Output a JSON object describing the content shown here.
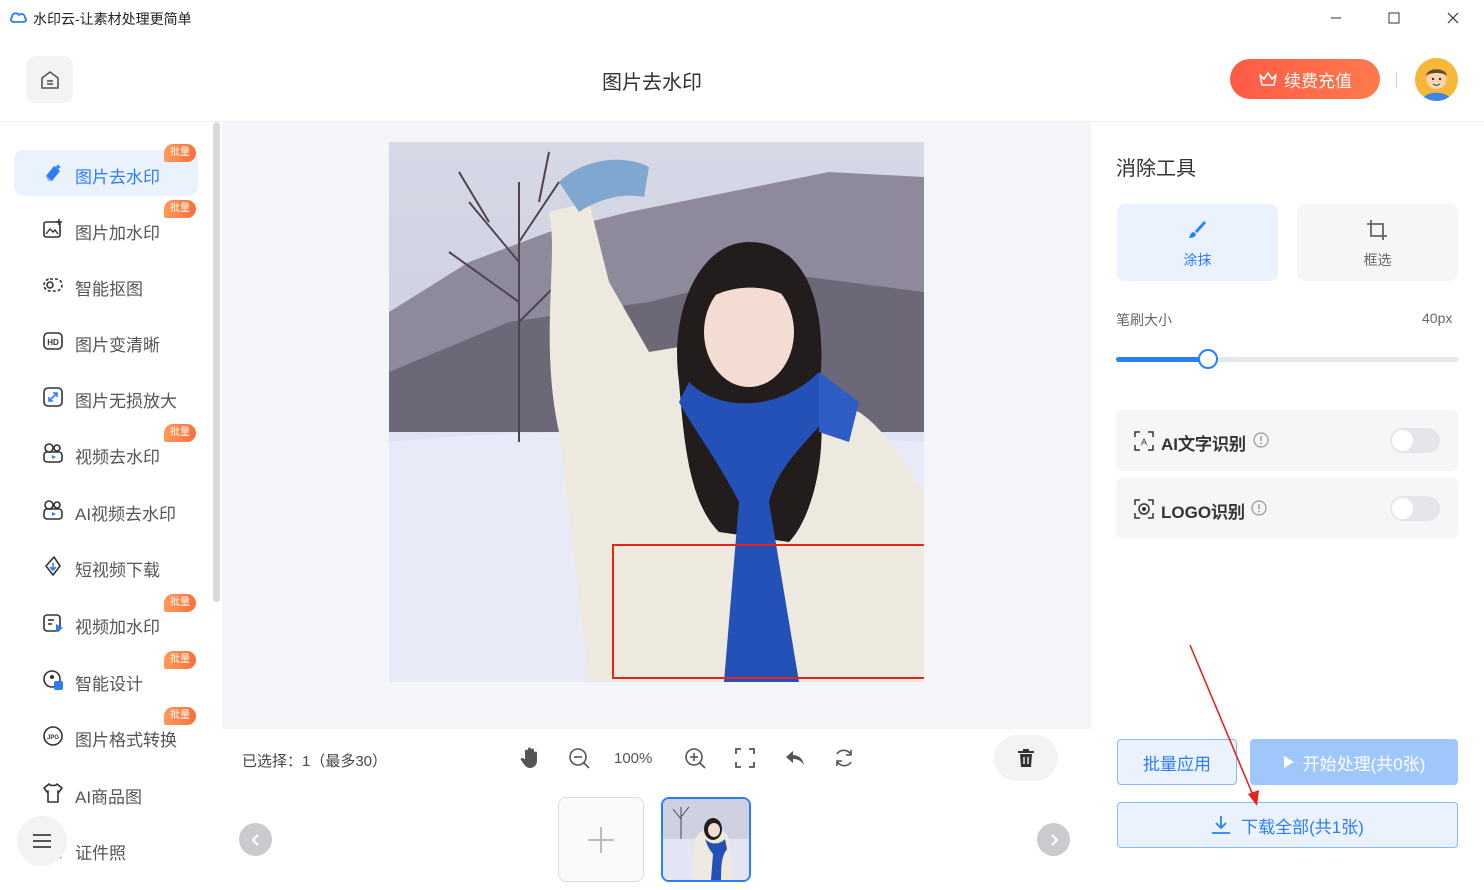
{
  "window": {
    "title": "水印云-让素材处理更简单"
  },
  "header": {
    "page_title": "图片去水印",
    "vip_label": "续费充值"
  },
  "sidebar": {
    "items": [
      {
        "label": "图片去水印",
        "icon": "eraser-icon",
        "badge": "批量",
        "active": true
      },
      {
        "label": "图片加水印",
        "icon": "image-add-icon",
        "badge": "批量"
      },
      {
        "label": "智能抠图",
        "icon": "cutout-icon",
        "badge": ""
      },
      {
        "label": "图片变清晰",
        "icon": "hd-icon",
        "badge": ""
      },
      {
        "label": "图片无损放大",
        "icon": "enlarge-icon",
        "badge": ""
      },
      {
        "label": "视频去水印",
        "icon": "video-eraser-icon",
        "badge": "批量"
      },
      {
        "label": "AI视频去水印",
        "icon": "ai-video-icon",
        "badge": ""
      },
      {
        "label": "短视频下载",
        "icon": "link-download-icon",
        "badge": ""
      },
      {
        "label": "视频加水印",
        "icon": "video-add-icon",
        "badge": "批量"
      },
      {
        "label": "智能设计",
        "icon": "design-icon",
        "badge": "批量"
      },
      {
        "label": "图片格式转换",
        "icon": "jpg-convert-icon",
        "badge": "批量"
      },
      {
        "label": "AI商品图",
        "icon": "shirt-icon",
        "badge": ""
      },
      {
        "label": "证件照",
        "icon": "id-photo-icon",
        "badge": ""
      }
    ]
  },
  "toolbar": {
    "selected_text": "已选择：1（最多30）",
    "zoom": "100%"
  },
  "right_panel": {
    "title": "消除工具",
    "tools": [
      {
        "label": "涂抹",
        "active": true
      },
      {
        "label": "框选",
        "active": false
      }
    ],
    "brush_label": "笔刷大小",
    "brush_value": "40px",
    "brush_level": 0.27,
    "options": [
      {
        "label": "AI文字识别",
        "enabled": false
      },
      {
        "label": "LOGO识别",
        "enabled": false
      }
    ],
    "batch_apply": "批量应用",
    "start_process": "开始处理(共0张)",
    "download_all": "下载全部(共1张)"
  },
  "colors": {
    "accent": "#2c7ef8",
    "vip": "#ff5a45",
    "badge": "#f5703a",
    "selection": "#e5241c"
  }
}
